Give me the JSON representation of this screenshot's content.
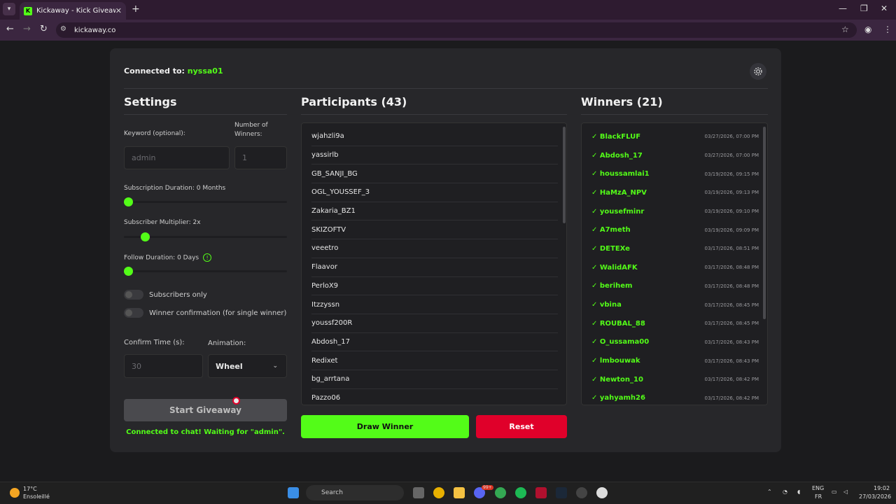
{
  "browser": {
    "tab_title": "Kickaway - Kick Giveaway Tool",
    "url": "kickaway.co"
  },
  "app": {
    "connected_label": "Connected to:",
    "channel": "nyssa01"
  },
  "settings": {
    "title": "Settings",
    "keyword_label": "Keyword (optional):",
    "keyword_placeholder": "admin",
    "winners_label": "Number of Winners:",
    "winners_placeholder": "1",
    "sub_duration_label": "Subscription Duration: 0 Months",
    "sub_duration_value": 0,
    "sub_multiplier_label": "Subscriber Multiplier: 2x",
    "sub_multiplier_value": 2,
    "follow_duration_label": "Follow Duration:  0  Days",
    "follow_duration_value": 0,
    "subscribers_only_label": "Subscribers only",
    "winner_confirm_label": "Winner confirmation (for single winner)",
    "confirm_time_label": "Confirm Time (s):",
    "confirm_time_placeholder": "30",
    "animation_label": "Animation:",
    "animation_value": "Wheel",
    "start_label": "Start Giveaway",
    "status": "Connected to chat! Waiting for \"admin\"."
  },
  "participants": {
    "title": "Participants (43)",
    "items": [
      "wjahzli9a",
      "yassirlb",
      "GB_SANJI_BG",
      "OGL_YOUSSEF_3",
      "Zakaria_BZ1",
      "SKIZOFTV",
      "veeetro",
      "Flaavor",
      "PerloX9",
      "Itzzyssn",
      "youssf200R",
      "Abdosh_17",
      "Redixet",
      "bg_arrtana",
      "Pazzo06"
    ],
    "draw_label": "Draw Winner",
    "reset_label": "Reset"
  },
  "winners": {
    "title": "Winners (21)",
    "items": [
      {
        "name": "✓ BlackFLUF",
        "date": "03/27/2026, 07:00 PM"
      },
      {
        "name": "✓ Abdosh_17",
        "date": "03/27/2026, 07:00 PM"
      },
      {
        "name": "✓ houssamlai1",
        "date": "03/19/2026, 09:15 PM"
      },
      {
        "name": "✓ HaMzA_NPV",
        "date": "03/19/2026, 09:13 PM"
      },
      {
        "name": "✓ yousefminr",
        "date": "03/19/2026, 09:10 PM"
      },
      {
        "name": "✓ A7meth",
        "date": "03/19/2026, 09:09 PM"
      },
      {
        "name": "✓ DETEXe",
        "date": "03/17/2026, 08:51 PM"
      },
      {
        "name": "✓ WalidAFK",
        "date": "03/17/2026, 08:48 PM"
      },
      {
        "name": "✓ berihem",
        "date": "03/17/2026, 08:48 PM"
      },
      {
        "name": "✓ vbina",
        "date": "03/17/2026, 08:45 PM"
      },
      {
        "name": "✓ ROUBAL_88",
        "date": "03/17/2026, 08:45 PM"
      },
      {
        "name": "✓ O_ussama00",
        "date": "03/17/2026, 08:43 PM"
      },
      {
        "name": "✓ lmbouwak",
        "date": "03/17/2026, 08:43 PM"
      },
      {
        "name": "✓ Newton_10",
        "date": "03/17/2026, 08:42 PM"
      },
      {
        "name": "✓ yahyamh26",
        "date": "03/17/2026, 08:42 PM"
      }
    ]
  },
  "taskbar": {
    "temp": "17°C",
    "weather": "Ensoleillé",
    "search": "Search",
    "lang1": "ENG",
    "lang2": "FR",
    "time": "19:02",
    "date": "27/03/2026",
    "badge": "99+"
  },
  "colors": {
    "accent": "#53fc18",
    "danger": "#e0002a",
    "card": "#27272a"
  }
}
